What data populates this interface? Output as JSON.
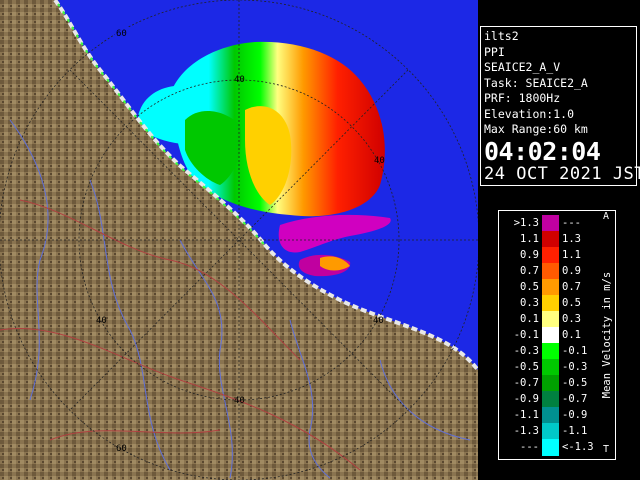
{
  "info": {
    "site": "ilts2",
    "scan": "PPI",
    "product": "SEAICE2_A_V",
    "task": "Task: SEAICE2_A",
    "prf": "PRF: 1800Hz",
    "elevation": "Elevation:1.0",
    "range": "Max Range:60 km",
    "time": "04:02:04",
    "date": "24 OCT 2021 JST"
  },
  "legend": {
    "title": "Mean Velocity in m/s",
    "away_marker": "A",
    "toward_marker": "T",
    "rows": [
      {
        "lo": ">1.3",
        "hi": "---",
        "color": "#c000a0"
      },
      {
        "lo": "1.1",
        "hi": "1.3",
        "color": "#d00000"
      },
      {
        "lo": "0.9",
        "hi": "1.1",
        "color": "#ff2000"
      },
      {
        "lo": "0.7",
        "hi": "0.9",
        "color": "#ff5a00"
      },
      {
        "lo": "0.5",
        "hi": "0.7",
        "color": "#ff9a00"
      },
      {
        "lo": "0.3",
        "hi": "0.5",
        "color": "#ffd000"
      },
      {
        "lo": "0.1",
        "hi": "0.3",
        "color": "#ffff80"
      },
      {
        "lo": "-0.1",
        "hi": "0.1",
        "color": "#ffffff"
      },
      {
        "lo": "-0.3",
        "hi": "-0.1",
        "color": "#00ff00"
      },
      {
        "lo": "-0.5",
        "hi": "-0.3",
        "color": "#00c800"
      },
      {
        "lo": "-0.7",
        "hi": "-0.5",
        "color": "#00a000"
      },
      {
        "lo": "-0.9",
        "hi": "-0.7",
        "color": "#008040"
      },
      {
        "lo": "-1.1",
        "hi": "-0.9",
        "color": "#009090"
      },
      {
        "lo": "-1.3",
        "hi": "-1.1",
        "color": "#00c8c8"
      },
      {
        "lo": "---",
        "hi": "<-1.3",
        "color": "#00ffff"
      }
    ]
  },
  "map": {
    "sea_color": "#1c28e6",
    "land_color": "#8a7450",
    "range_rings_km": [
      "40",
      "60"
    ],
    "ring_labels": [
      "60",
      "40",
      "40",
      "40",
      "40",
      "40",
      "60"
    ]
  }
}
